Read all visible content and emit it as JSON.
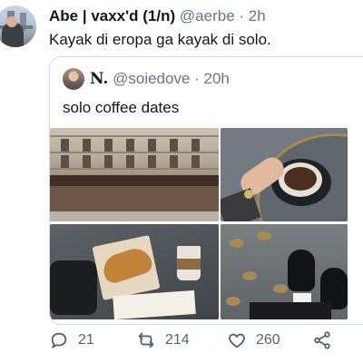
{
  "tweet": {
    "author_name": "Abe | vaxx'd (1/n)",
    "handle_time": "@aerbe · 2h",
    "text": "Kayak di eropa ga kayak di solo."
  },
  "quote": {
    "author_name": "N.",
    "handle_time": "@soiedove · 20h",
    "text": "solo coffee dates"
  },
  "actions": {
    "reply_count": "21",
    "retweet_count": "214",
    "like_count": "260"
  },
  "icons": [
    "reply-icon",
    "retweet-icon",
    "like-icon",
    "share-icon"
  ],
  "colors": {
    "text": "#14171a",
    "secondary": "#657786",
    "border": "#cfd9de"
  }
}
